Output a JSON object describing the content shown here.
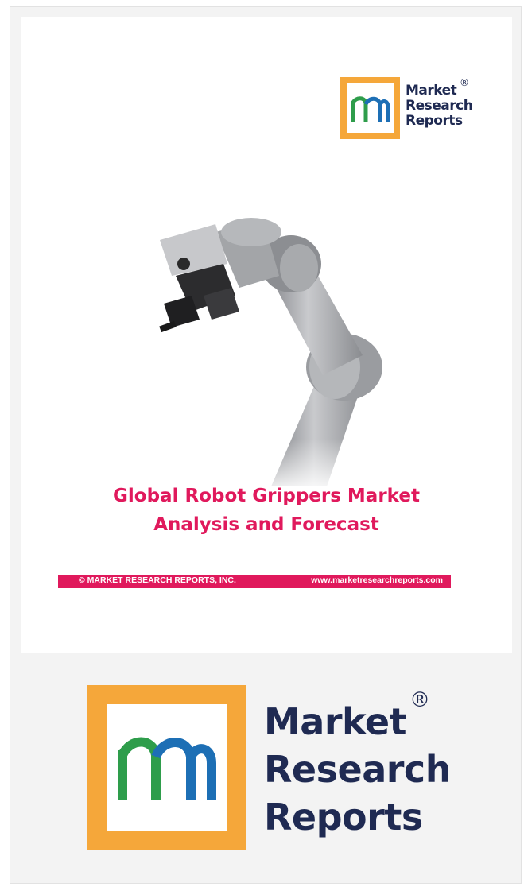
{
  "cover": {
    "logo": {
      "letter": "m",
      "lines": [
        "Market",
        "Research",
        "Reports"
      ],
      "registered": "®"
    },
    "image": {
      "subject": "collaborative robot arm with gripper"
    },
    "title_lines": [
      "Global Robot Grippers Market",
      "Analysis and Forecast"
    ],
    "footer_band": {
      "copyright": "© MARKET RESEARCH REPORTS, INC.",
      "website": "www.marketresearchreports.com"
    }
  },
  "brand": {
    "letter": "m",
    "lines": [
      "Market",
      "Research",
      "Reports"
    ],
    "registered": "®"
  },
  "colors": {
    "accent": "#e0195c",
    "logo_frame": "#f5a73a",
    "logo_text": "#1f2a52",
    "logo_green": "#2e9d4b",
    "logo_blue": "#1d6fb5"
  }
}
